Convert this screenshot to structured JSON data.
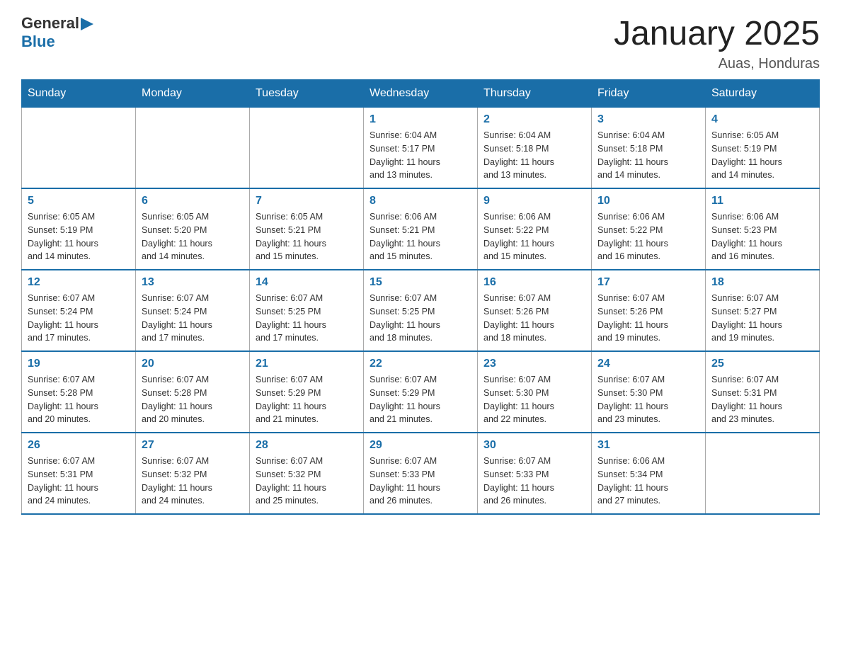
{
  "header": {
    "logo": {
      "general": "General",
      "blue": "Blue"
    },
    "title": "January 2025",
    "subtitle": "Auas, Honduras"
  },
  "weekdays": [
    "Sunday",
    "Monday",
    "Tuesday",
    "Wednesday",
    "Thursday",
    "Friday",
    "Saturday"
  ],
  "weeks": [
    [
      {
        "day": "",
        "info": ""
      },
      {
        "day": "",
        "info": ""
      },
      {
        "day": "",
        "info": ""
      },
      {
        "day": "1",
        "info": "Sunrise: 6:04 AM\nSunset: 5:17 PM\nDaylight: 11 hours\nand 13 minutes."
      },
      {
        "day": "2",
        "info": "Sunrise: 6:04 AM\nSunset: 5:18 PM\nDaylight: 11 hours\nand 13 minutes."
      },
      {
        "day": "3",
        "info": "Sunrise: 6:04 AM\nSunset: 5:18 PM\nDaylight: 11 hours\nand 14 minutes."
      },
      {
        "day": "4",
        "info": "Sunrise: 6:05 AM\nSunset: 5:19 PM\nDaylight: 11 hours\nand 14 minutes."
      }
    ],
    [
      {
        "day": "5",
        "info": "Sunrise: 6:05 AM\nSunset: 5:19 PM\nDaylight: 11 hours\nand 14 minutes."
      },
      {
        "day": "6",
        "info": "Sunrise: 6:05 AM\nSunset: 5:20 PM\nDaylight: 11 hours\nand 14 minutes."
      },
      {
        "day": "7",
        "info": "Sunrise: 6:05 AM\nSunset: 5:21 PM\nDaylight: 11 hours\nand 15 minutes."
      },
      {
        "day": "8",
        "info": "Sunrise: 6:06 AM\nSunset: 5:21 PM\nDaylight: 11 hours\nand 15 minutes."
      },
      {
        "day": "9",
        "info": "Sunrise: 6:06 AM\nSunset: 5:22 PM\nDaylight: 11 hours\nand 15 minutes."
      },
      {
        "day": "10",
        "info": "Sunrise: 6:06 AM\nSunset: 5:22 PM\nDaylight: 11 hours\nand 16 minutes."
      },
      {
        "day": "11",
        "info": "Sunrise: 6:06 AM\nSunset: 5:23 PM\nDaylight: 11 hours\nand 16 minutes."
      }
    ],
    [
      {
        "day": "12",
        "info": "Sunrise: 6:07 AM\nSunset: 5:24 PM\nDaylight: 11 hours\nand 17 minutes."
      },
      {
        "day": "13",
        "info": "Sunrise: 6:07 AM\nSunset: 5:24 PM\nDaylight: 11 hours\nand 17 minutes."
      },
      {
        "day": "14",
        "info": "Sunrise: 6:07 AM\nSunset: 5:25 PM\nDaylight: 11 hours\nand 17 minutes."
      },
      {
        "day": "15",
        "info": "Sunrise: 6:07 AM\nSunset: 5:25 PM\nDaylight: 11 hours\nand 18 minutes."
      },
      {
        "day": "16",
        "info": "Sunrise: 6:07 AM\nSunset: 5:26 PM\nDaylight: 11 hours\nand 18 minutes."
      },
      {
        "day": "17",
        "info": "Sunrise: 6:07 AM\nSunset: 5:26 PM\nDaylight: 11 hours\nand 19 minutes."
      },
      {
        "day": "18",
        "info": "Sunrise: 6:07 AM\nSunset: 5:27 PM\nDaylight: 11 hours\nand 19 minutes."
      }
    ],
    [
      {
        "day": "19",
        "info": "Sunrise: 6:07 AM\nSunset: 5:28 PM\nDaylight: 11 hours\nand 20 minutes."
      },
      {
        "day": "20",
        "info": "Sunrise: 6:07 AM\nSunset: 5:28 PM\nDaylight: 11 hours\nand 20 minutes."
      },
      {
        "day": "21",
        "info": "Sunrise: 6:07 AM\nSunset: 5:29 PM\nDaylight: 11 hours\nand 21 minutes."
      },
      {
        "day": "22",
        "info": "Sunrise: 6:07 AM\nSunset: 5:29 PM\nDaylight: 11 hours\nand 21 minutes."
      },
      {
        "day": "23",
        "info": "Sunrise: 6:07 AM\nSunset: 5:30 PM\nDaylight: 11 hours\nand 22 minutes."
      },
      {
        "day": "24",
        "info": "Sunrise: 6:07 AM\nSunset: 5:30 PM\nDaylight: 11 hours\nand 23 minutes."
      },
      {
        "day": "25",
        "info": "Sunrise: 6:07 AM\nSunset: 5:31 PM\nDaylight: 11 hours\nand 23 minutes."
      }
    ],
    [
      {
        "day": "26",
        "info": "Sunrise: 6:07 AM\nSunset: 5:31 PM\nDaylight: 11 hours\nand 24 minutes."
      },
      {
        "day": "27",
        "info": "Sunrise: 6:07 AM\nSunset: 5:32 PM\nDaylight: 11 hours\nand 24 minutes."
      },
      {
        "day": "28",
        "info": "Sunrise: 6:07 AM\nSunset: 5:32 PM\nDaylight: 11 hours\nand 25 minutes."
      },
      {
        "day": "29",
        "info": "Sunrise: 6:07 AM\nSunset: 5:33 PM\nDaylight: 11 hours\nand 26 minutes."
      },
      {
        "day": "30",
        "info": "Sunrise: 6:07 AM\nSunset: 5:33 PM\nDaylight: 11 hours\nand 26 minutes."
      },
      {
        "day": "31",
        "info": "Sunrise: 6:06 AM\nSunset: 5:34 PM\nDaylight: 11 hours\nand 27 minutes."
      },
      {
        "day": "",
        "info": ""
      }
    ]
  ]
}
